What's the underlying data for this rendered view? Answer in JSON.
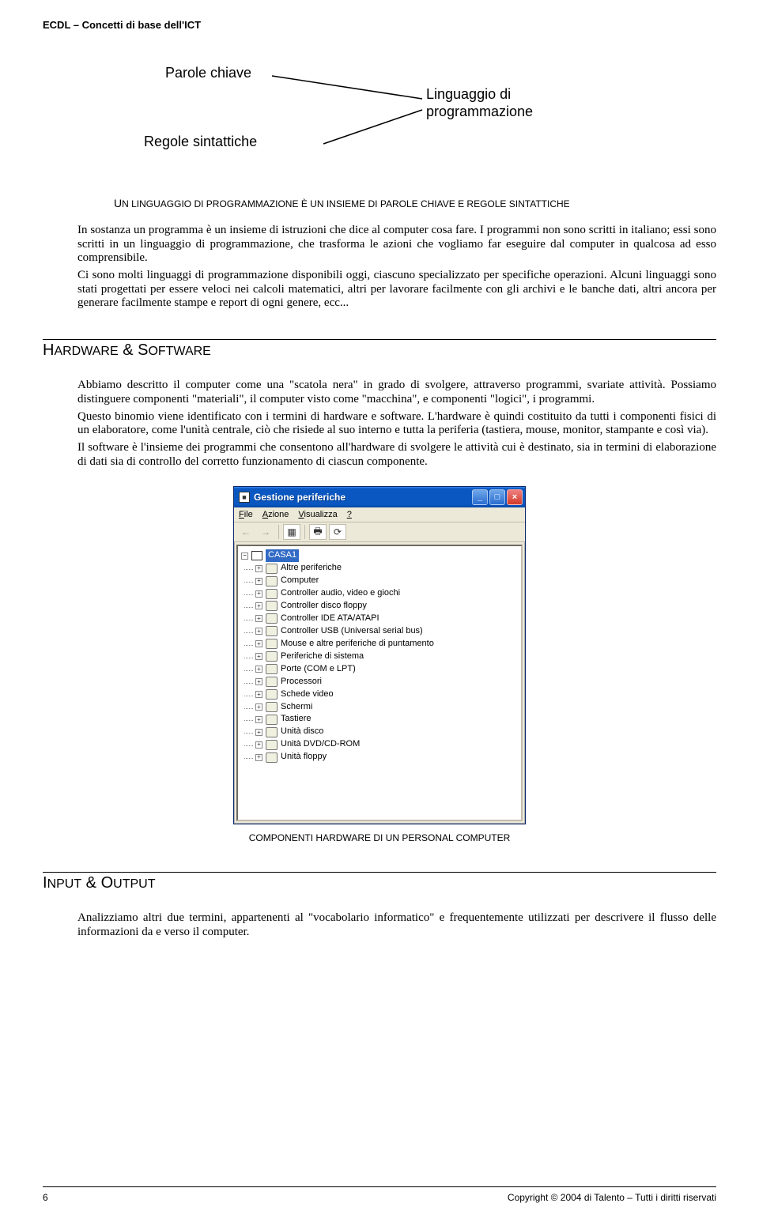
{
  "header": {
    "title": "ECDL – Concetti di base dell'ICT"
  },
  "diagram": {
    "top": "Parole chiave",
    "left": "Regole sintattiche",
    "right_line1": "Linguaggio di",
    "right_line2": "programmazione",
    "caption_pre": "U",
    "caption_rest": "N LINGUAGGIO DI PROGRAMMAZIONE È UN INSIEME DI PAROLE CHIAVE E REGOLE SINTATTICHE"
  },
  "para1": "In sostanza un programma è un insieme di istruzioni che dice al computer cosa fare. I programmi non sono scritti in italiano; essi sono scritti in un linguaggio di programmazione, che trasforma le azioni che vogliamo far eseguire dal computer in qualcosa ad esso comprensibile.",
  "para2": "Ci sono molti linguaggi di programmazione disponibili oggi, ciascuno specializzato per specifiche operazioni. Alcuni linguaggi sono stati progettati per essere veloci nei calcoli matematici, altri per lavorare facilmente con gli archivi e le banche dati, altri ancora per generare facilmente stampe e report di ogni genere, ecc...",
  "section_hw": {
    "title": "HARDWARE & SOFTWARE",
    "p1": "Abbiamo descritto il computer come una \"scatola nera\" in grado di svolgere, attraverso programmi, svariate attività. Possiamo distinguere componenti \"materiali\", il computer visto come \"macchina\", e componenti \"logici\", i programmi.",
    "p2": "Questo binomio viene identificato con i termini di hardware e software. L'hardware è quindi costituito da tutti i componenti fisici di un elaboratore, come l'unità centrale, ciò che risiede al suo interno e tutta la periferia (tastiera, mouse, monitor, stampante e così via).",
    "p3": "Il software è l'insieme dei programmi che consentono all'hardware di svolgere le attività cui è destinato, sia in termini di elaborazione di dati sia di controllo del corretto funzionamento di ciascun componente."
  },
  "window": {
    "title": "Gestione periferiche",
    "menu": [
      "File",
      "Azione",
      "Visualizza",
      "?"
    ],
    "root": "CASA1",
    "nodes": [
      "Altre periferiche",
      "Computer",
      "Controller audio, video e giochi",
      "Controller disco floppy",
      "Controller IDE ATA/ATAPI",
      "Controller USB (Universal serial bus)",
      "Mouse e altre periferiche di puntamento",
      "Periferiche di sistema",
      "Porte (COM e LPT)",
      "Processori",
      "Schede video",
      "Schermi",
      "Tastiere",
      "Unità disco",
      "Unità DVD/CD-ROM",
      "Unità floppy"
    ],
    "caption": "COMPONENTI HARDWARE DI UN PERSONAL COMPUTER"
  },
  "section_io": {
    "title": "INPUT & OUTPUT",
    "p1": "Analizziamo altri due termini, appartenenti al \"vocabolario informatico\" e frequentemente utilizzati per descrivere il flusso delle informazioni da e verso il computer."
  },
  "footer": {
    "page": "6",
    "copyright": "Copyright © 2004 di Talento – Tutti i diritti riservati"
  }
}
